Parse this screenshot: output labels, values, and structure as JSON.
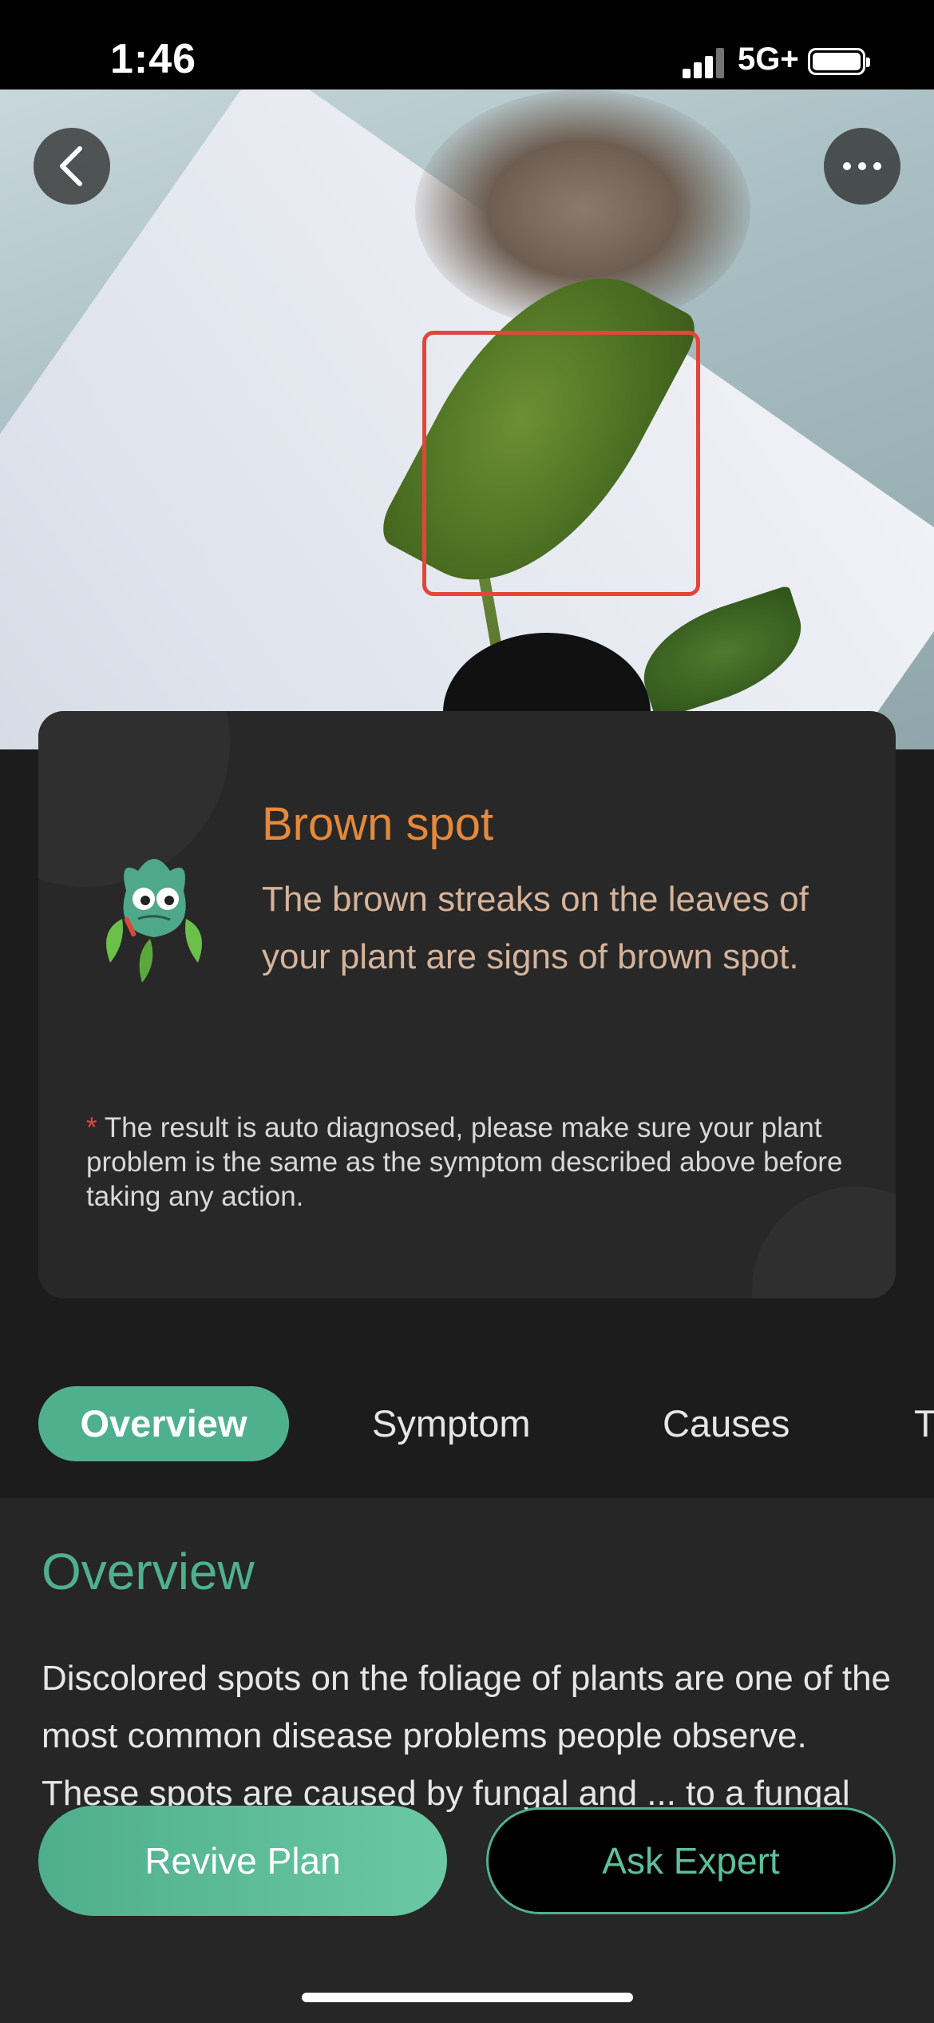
{
  "status_bar": {
    "time": "1:46",
    "network": "5G+"
  },
  "icons": {
    "back": "chevron-left-icon",
    "more": "more-horizontal-icon",
    "mascot": "sick-plant-mascot-icon"
  },
  "diagnosis": {
    "title": "Brown spot",
    "description": "The brown streaks on the leaves of your plant are signs of brown spot.",
    "note_marker": "*",
    "note": "The result is auto diagnosed, please make sure your plant problem is the same as the symptom described above before taking any action."
  },
  "tabs": [
    {
      "label": "Overview",
      "active": true
    },
    {
      "label": "Symptom",
      "active": false
    },
    {
      "label": "Causes",
      "active": false
    },
    {
      "label": "T",
      "active": false
    }
  ],
  "section": {
    "title": "Overview",
    "body": "Discolored spots on the foliage of plants are one of the most common disease problems people observe. These spots are caused by fungal and ... to a fungal pathogen."
  },
  "actions": {
    "revive_plan": "Revive Plan",
    "ask_expert": "Ask Expert"
  },
  "colors": {
    "accent_green": "#4fb08e",
    "title_orange": "#e4893c",
    "detect_box_red": "#e0473b"
  }
}
